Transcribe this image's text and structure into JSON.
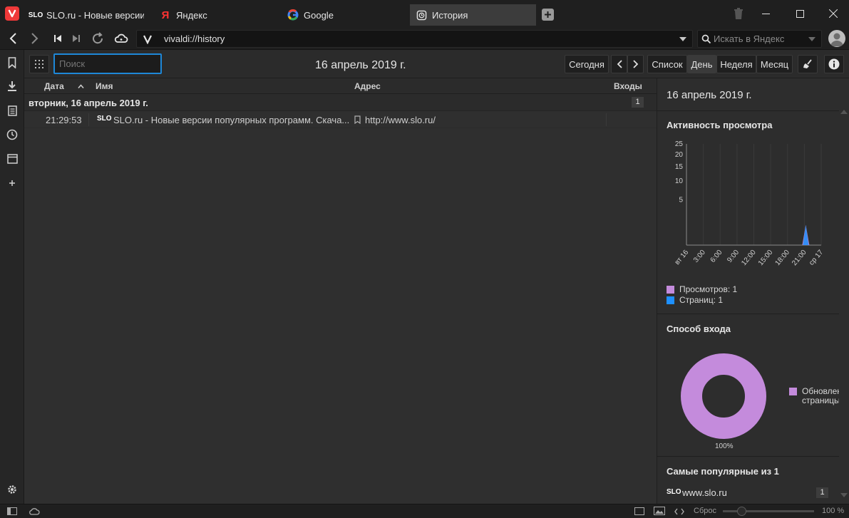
{
  "tabs": [
    {
      "title": "SLO.ru - Новые версии популярных программ",
      "favicon": "slo-logo"
    },
    {
      "title": "Яндекс",
      "favicon": "yandex-logo"
    },
    {
      "title": "Google",
      "favicon": "google-logo"
    },
    {
      "title": "История",
      "favicon": "history-icon"
    }
  ],
  "address": {
    "url": "vivaldi://history",
    "search_placeholder": "Искать в Яндекс"
  },
  "toolbar": {
    "search_placeholder": "Поиск",
    "date_title": "16 апрель 2019 г.",
    "today_label": "Сегодня",
    "view_list": "Список",
    "view_day": "День",
    "view_week": "Неделя",
    "view_month": "Месяц"
  },
  "columns": {
    "date": "Дата",
    "name": "Имя",
    "address": "Адрес",
    "visits": "Входы"
  },
  "group": {
    "label": "вторник, 16 апрель 2019 г.",
    "count": "1"
  },
  "rows": [
    {
      "time": "21:29:53",
      "title": "SLO.ru - Новые версии популярных программ. Скача...",
      "url": "http://www.slo.ru/"
    }
  ],
  "stats": {
    "date": "16 апрель 2019 г.",
    "activity_title": "Активность просмотра",
    "legend_views": "Просмотров: 1",
    "legend_pages": "Страниц: 1",
    "entry_title": "Способ входа",
    "entry_legend": "Обновление страницы",
    "entry_legend_line1": "Обновлен",
    "entry_legend_line2": "страницы",
    "entry_percent": "100%",
    "popular_title": "Самые популярные из 1",
    "popular": [
      {
        "domain": "www.slo.ru",
        "count": "1"
      }
    ]
  },
  "chart_data": [
    {
      "type": "area",
      "title": "Активность просмотра",
      "x_ticks": [
        "вт 16",
        "3:00",
        "6:00",
        "9:00",
        "12:00",
        "15:00",
        "18:00",
        "21:00",
        "ср 17"
      ],
      "y_ticks": [
        "25",
        "20",
        "15",
        "10",
        "5"
      ],
      "ylim": [
        0,
        25
      ],
      "series": [
        {
          "name": "Просмотров: 1",
          "color": "#c48bdc",
          "x": [
            "21:00"
          ],
          "values": [
            1
          ]
        },
        {
          "name": "Страниц: 1",
          "color": "#1e90ff",
          "x": [
            "21:00"
          ],
          "values": [
            1
          ]
        }
      ],
      "legend": "bottom-left"
    },
    {
      "type": "pie",
      "title": "Способ входа",
      "slices": [
        {
          "label": "Обновление страницы",
          "value": 100,
          "color": "#c48bdc"
        }
      ],
      "labels": [
        "100%"
      ],
      "legend": "right"
    }
  ],
  "colors": {
    "accent": "#1e88d8",
    "vivaldi": "#ef3939",
    "pie": "#c48bdc",
    "pages": "#1e90ff"
  },
  "status": {
    "reset_label": "Сброс",
    "zoom": "100 %"
  }
}
